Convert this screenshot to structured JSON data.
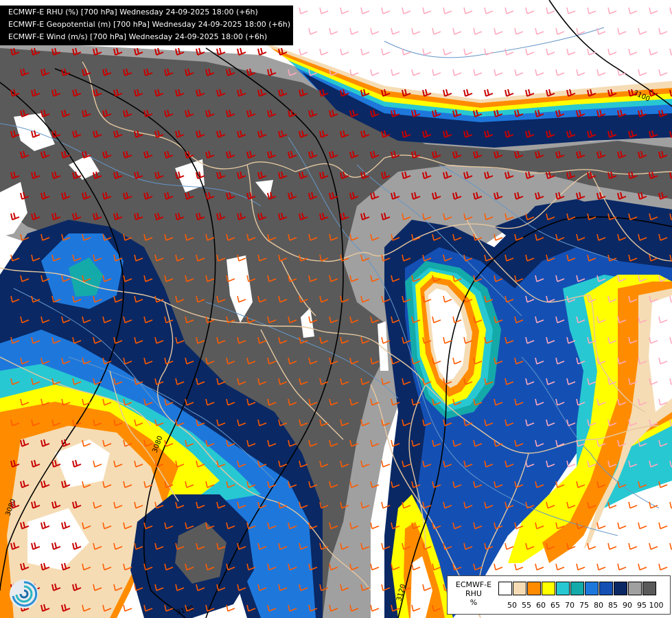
{
  "header": {
    "line1": "ECMWF-E RHU (%) [700 hPa] Wednesday 24-09-2025 18:00 (+6h)",
    "line2": "ECMWF-E Geopotential (m) [700 hPa] Wednesday 24-09-2025 18:00 (+6h)",
    "line3": "ECMWF-E Wind (m/s) [700 hPa] Wednesday 24-09-2025 18:00 (+6h)"
  },
  "legend": {
    "title_line1": "ECMWF-E",
    "title_line2": "RHU",
    "title_line3": "%",
    "bins": [
      {
        "label": "",
        "color": "#ffffff"
      },
      {
        "label": "50",
        "color": "#f5dcb4"
      },
      {
        "label": "55",
        "color": "#ff8c00"
      },
      {
        "label": "60",
        "color": "#ffff00"
      },
      {
        "label": "65",
        "color": "#28c8d2"
      },
      {
        "label": "70",
        "color": "#14aaaa"
      },
      {
        "label": "75",
        "color": "#1e78dc"
      },
      {
        "label": "80",
        "color": "#1450b4"
      },
      {
        "label": "85",
        "color": "#0a2864"
      },
      {
        "label": "90",
        "color": "#a0a0a0"
      },
      {
        "label": "95",
        "color": "#5a5a5a"
      },
      {
        "label": "100",
        "color": ""
      }
    ]
  },
  "contours": {
    "labels": [
      "3100",
      "3080",
      "3080",
      "3100",
      "3120"
    ]
  },
  "colors": {
    "humidity_100": "#5a5a5a",
    "humidity_95": "#a0a0a0",
    "humidity_90": "#0a2864",
    "humidity_85": "#1450b4",
    "humidity_80": "#1e78dc",
    "humidity_75": "#14aaaa",
    "humidity_70": "#28c8d2",
    "humidity_65": "#ffff00",
    "humidity_60": "#ff8c00",
    "humidity_55": "#f5dcb4",
    "borders": "#e6c8a0",
    "rivers": "#6496c8",
    "wind_strong": "#c80000",
    "wind_medium": "#ff5a00",
    "wind_light": "#ffaabe"
  },
  "logo": {
    "icon": "ecmwf-swirl-logo"
  }
}
